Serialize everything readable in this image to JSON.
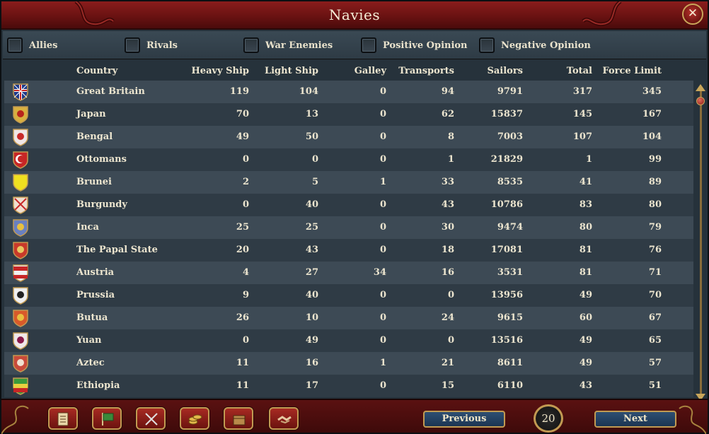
{
  "window": {
    "title": "Navies"
  },
  "filters": [
    {
      "label": "Allies"
    },
    {
      "label": "Rivals"
    },
    {
      "label": "War Enemies"
    },
    {
      "label": "Positive Opinion"
    },
    {
      "label": "Negative Opinion"
    }
  ],
  "table": {
    "columns": [
      "Country",
      "Heavy Ship",
      "Light Ship",
      "Galley",
      "Transports",
      "Sailors",
      "Total",
      "Force Limit"
    ],
    "rows": [
      {
        "flag": "great-britain-flag",
        "country": "Great Britain",
        "heavy": "119",
        "light": "104",
        "galley": "0",
        "transports": "94",
        "sailors": "9791",
        "total": "317",
        "force_limit": "345"
      },
      {
        "flag": "japan-flag",
        "country": "Japan",
        "heavy": "70",
        "light": "13",
        "galley": "0",
        "transports": "62",
        "sailors": "15837",
        "total": "145",
        "force_limit": "167"
      },
      {
        "flag": "bengal-flag",
        "country": "Bengal",
        "heavy": "49",
        "light": "50",
        "galley": "0",
        "transports": "8",
        "sailors": "7003",
        "total": "107",
        "force_limit": "104"
      },
      {
        "flag": "ottomans-flag",
        "country": "Ottomans",
        "heavy": "0",
        "light": "0",
        "galley": "0",
        "transports": "1",
        "sailors": "21829",
        "total": "1",
        "force_limit": "99"
      },
      {
        "flag": "brunei-flag",
        "country": "Brunei",
        "heavy": "2",
        "light": "5",
        "galley": "1",
        "transports": "33",
        "sailors": "8535",
        "total": "41",
        "force_limit": "89"
      },
      {
        "flag": "burgundy-flag",
        "country": "Burgundy",
        "heavy": "0",
        "light": "40",
        "galley": "0",
        "transports": "43",
        "sailors": "10786",
        "total": "83",
        "force_limit": "80"
      },
      {
        "flag": "inca-flag",
        "country": "Inca",
        "heavy": "25",
        "light": "25",
        "galley": "0",
        "transports": "30",
        "sailors": "9474",
        "total": "80",
        "force_limit": "79"
      },
      {
        "flag": "papal-state-flag",
        "country": "The Papal State",
        "heavy": "20",
        "light": "43",
        "galley": "0",
        "transports": "18",
        "sailors": "17081",
        "total": "81",
        "force_limit": "76"
      },
      {
        "flag": "austria-flag",
        "country": "Austria",
        "heavy": "4",
        "light": "27",
        "galley": "34",
        "transports": "16",
        "sailors": "3531",
        "total": "81",
        "force_limit": "71"
      },
      {
        "flag": "prussia-flag",
        "country": "Prussia",
        "heavy": "9",
        "light": "40",
        "galley": "0",
        "transports": "0",
        "sailors": "13956",
        "total": "49",
        "force_limit": "70"
      },
      {
        "flag": "butua-flag",
        "country": "Butua",
        "heavy": "26",
        "light": "10",
        "galley": "0",
        "transports": "24",
        "sailors": "9615",
        "total": "60",
        "force_limit": "67"
      },
      {
        "flag": "yuan-flag",
        "country": "Yuan",
        "heavy": "0",
        "light": "49",
        "galley": "0",
        "transports": "0",
        "sailors": "13516",
        "total": "49",
        "force_limit": "65"
      },
      {
        "flag": "aztec-flag",
        "country": "Aztec",
        "heavy": "11",
        "light": "16",
        "galley": "1",
        "transports": "21",
        "sailors": "8611",
        "total": "49",
        "force_limit": "57"
      },
      {
        "flag": "ethiopia-flag",
        "country": "Ethiopia",
        "heavy": "11",
        "light": "17",
        "galley": "0",
        "transports": "15",
        "sailors": "6110",
        "total": "43",
        "force_limit": "51"
      }
    ]
  },
  "bottom": {
    "tools": [
      "ledger-icon",
      "flag-icon",
      "crossed-swords-icon",
      "coins-icon",
      "crate-icon",
      "handshake-icon"
    ],
    "previous_label": "Previous",
    "next_label": "Next",
    "page": "20"
  },
  "colors": {
    "title_red": "#6a1212",
    "row_even": "#3d4a55",
    "row_odd": "#2f3b45",
    "gold": "#c29a52",
    "button_blue": "#2e4f73"
  }
}
